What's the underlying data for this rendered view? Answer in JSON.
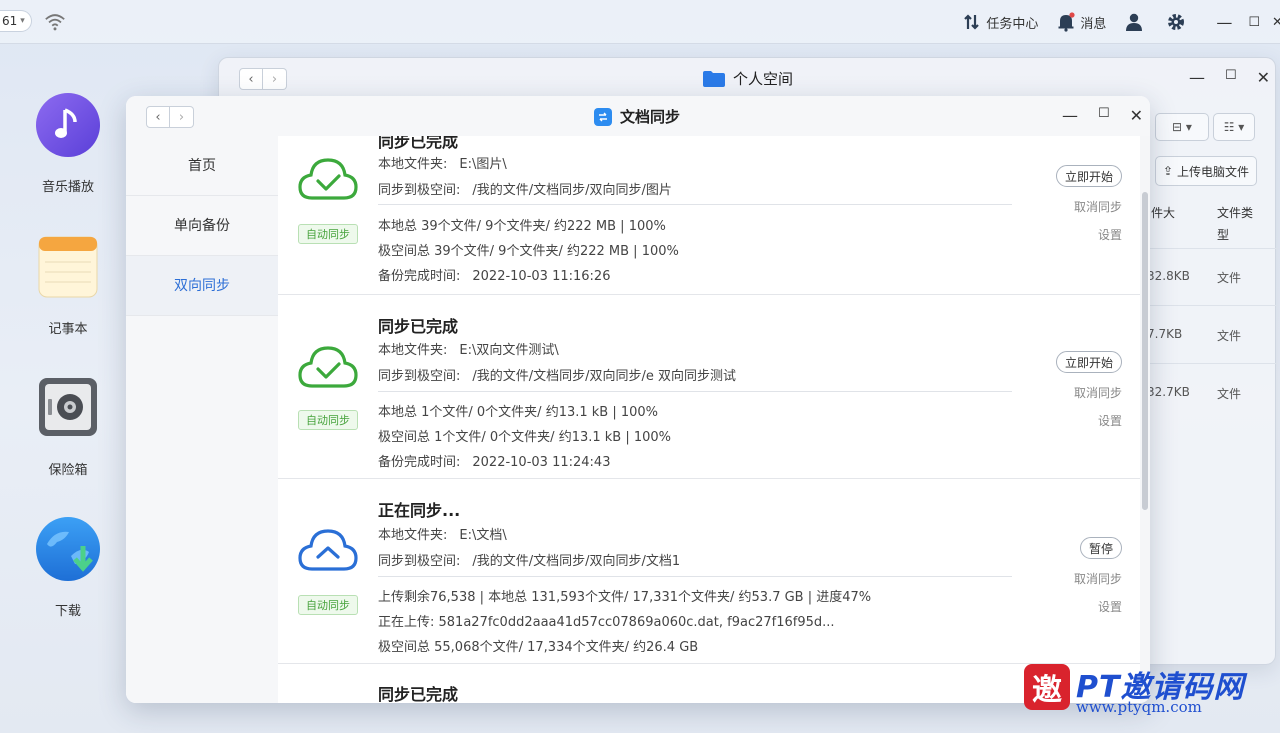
{
  "topbar": {
    "badge": "61",
    "items": [
      {
        "icon": "transfer-icon",
        "label": "任务中心"
      },
      {
        "icon": "bell-icon",
        "label": "消息"
      }
    ]
  },
  "desktop": {
    "apps": [
      {
        "icon": "music-icon",
        "label": "音乐播放"
      },
      {
        "icon": "notepad-icon",
        "label": "记事本"
      },
      {
        "icon": "safe-icon",
        "label": "保险箱"
      },
      {
        "icon": "download-icon",
        "label": "下载"
      }
    ]
  },
  "back_window": {
    "title": "个人空间",
    "upload_label": "上传电脑文件",
    "columns": [
      "件大",
      "文件类型"
    ],
    "rows": [
      {
        "size": "32.8KB",
        "type": "文件"
      },
      {
        "size": "7.7KB",
        "type": "文件"
      },
      {
        "size": "32.7KB",
        "type": "文件"
      }
    ]
  },
  "front_window": {
    "title": "文档同步",
    "sidebar": [
      "首页",
      "单向备份",
      "双向同步"
    ],
    "active_index": 2,
    "cards": [
      {
        "title": "同步已完成",
        "local_label": "本地文件夹:",
        "local_value": "E:\\图片\\",
        "remote_label": "同步到极空间:",
        "remote_value": "/我的文件/文档同步/双向同步/图片",
        "line1": "本地总 39个文件/ 9个文件夹/ 约222 MB | 100%",
        "line2": "极空间总 39个文件/ 9个文件夹/ 约222 MB | 100%",
        "line3_label": "备份完成时间:",
        "line3_value": "2022-10-03 11:16:26",
        "tag": "自动同步",
        "action": "立即开始",
        "cancel": "取消同步",
        "settings": "设置",
        "status": "done"
      },
      {
        "title": "同步已完成",
        "local_label": "本地文件夹:",
        "local_value": "E:\\双向文件测试\\",
        "remote_label": "同步到极空间:",
        "remote_value": "/我的文件/文档同步/双向同步/e 双向同步测试",
        "line1": "本地总 1个文件/ 0个文件夹/ 约13.1 kB | 100%",
        "line2": "极空间总 1个文件/ 0个文件夹/ 约13.1 kB | 100%",
        "line3_label": "备份完成时间:",
        "line3_value": "2022-10-03 11:24:43",
        "tag": "自动同步",
        "action": "立即开始",
        "cancel": "取消同步",
        "settings": "设置",
        "status": "done"
      },
      {
        "title": "正在同步...",
        "local_label": "本地文件夹:",
        "local_value": "E:\\文档\\",
        "remote_label": "同步到极空间:",
        "remote_value": "/我的文件/文档同步/双向同步/文档1",
        "line1": "上传剩余76,538  |  本地总 131,593个文件/ 17,331个文件夹/ 约53.7 GB  |  进度47%",
        "line2": "正在上传:   581a27fc0dd2aaa41d57cc07869a060c.dat, f9ac27f16f95d...",
        "line3_label": "",
        "line3_value": "极空间总 55,068个文件/ 17,334个文件夹/ 约26.4 GB",
        "tag": "自动同步",
        "action": "暂停",
        "cancel": "取消同步",
        "settings": "设置",
        "status": "syncing"
      },
      {
        "title": "同步已完成"
      }
    ]
  },
  "watermark": {
    "logo_char": "邀",
    "name": "PT邀请码网",
    "url": "www.ptyqm.com"
  },
  "colors": {
    "accent": "#2d6fd6",
    "done_green": "#3ca93c",
    "syncing_blue": "#2a6fd6",
    "tag_green": "#47a33c"
  }
}
